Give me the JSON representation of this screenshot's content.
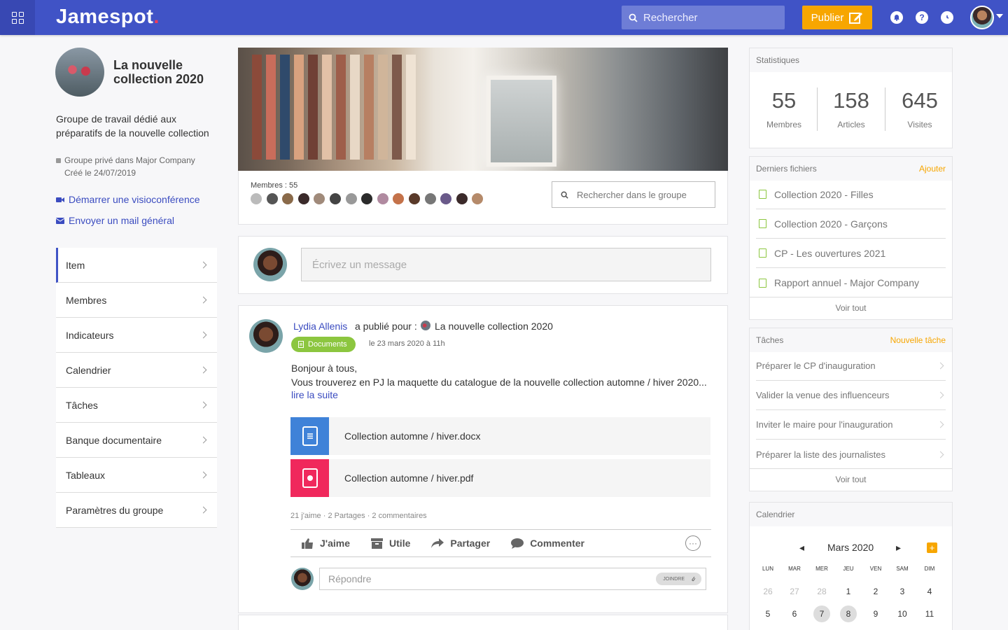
{
  "app": {
    "logo": "Jamespot",
    "logo_dot": ".",
    "search_placeholder": "Rechercher",
    "publish_label": "Publier",
    "colors": {
      "primary": "#4053c6",
      "accent": "#f7a600",
      "pink": "#ef3b5a",
      "green": "#8cc63f"
    },
    "icons": [
      "apps-grid-icon",
      "search-icon",
      "edit-icon",
      "notification-bell-icon",
      "help-icon",
      "clock-icon"
    ]
  },
  "group": {
    "title": "La nouvelle collection 2020",
    "description": "Groupe de travail dédié aux préparatifs de la nouvelle collection",
    "privacy": "Groupe privé dans Major Company",
    "created": "Créé le 24/07/2019",
    "links": [
      {
        "label": "Démarrer une visioconférence",
        "icon": "video-camera-icon"
      },
      {
        "label": "Envoyer un mail général",
        "icon": "envelope-icon"
      }
    ],
    "nav": [
      {
        "label": "Item"
      },
      {
        "label": "Membres"
      },
      {
        "label": "Indicateurs"
      },
      {
        "label": "Calendrier"
      },
      {
        "label": "Tâches"
      },
      {
        "label": "Banque documentaire"
      },
      {
        "label": "Tableaux"
      },
      {
        "label": "Paramètres du groupe"
      }
    ]
  },
  "main": {
    "members_label": "Membres : 55",
    "group_search_placeholder": "Rechercher dans le groupe",
    "compose_placeholder": "Écrivez un message",
    "post": {
      "author": "Lydia Allenis",
      "published_for": "a publié pour :",
      "target": "La nouvelle collection 2020",
      "tag": "Documents",
      "date": "le 23 mars 2020 à 11h",
      "line1": "Bonjour à tous,",
      "line2": "Vous trouverez en PJ la maquette du catalogue de la nouvelle collection automne / hiver 2020...",
      "read_more": "lire la suite",
      "files": [
        {
          "name": "Collection automne / hiver.docx",
          "color": "#3f82d8",
          "icon": "document-icon"
        },
        {
          "name": "Collection automne / hiver.pdf",
          "color": "#f0285c",
          "icon": "pdf-icon"
        }
      ],
      "stats": "21 j'aime · 2 Partages · 2 commentaires",
      "actions": [
        {
          "label": "J'aime",
          "icon": "thumbs-up-icon"
        },
        {
          "label": "Utile",
          "icon": "archive-icon"
        },
        {
          "label": "Partager",
          "icon": "share-icon"
        },
        {
          "label": "Commenter",
          "icon": "comment-icon"
        }
      ],
      "more": "···",
      "reply_placeholder": "Répondre",
      "attach_label": "JOINDRE"
    }
  },
  "sidebar": {
    "stats": {
      "title": "Statistiques",
      "items": [
        {
          "value": "55",
          "label": "Membres"
        },
        {
          "value": "158",
          "label": "Articles"
        },
        {
          "value": "645",
          "label": "Visites"
        }
      ]
    },
    "files": {
      "title": "Derniers fichiers",
      "action": "Ajouter",
      "items": [
        "Collection 2020 - Filles",
        "Collection 2020 - Garçons",
        "CP - Les ouvertures 2021",
        "Rapport annuel - Major Company"
      ],
      "see_all": "Voir tout"
    },
    "tasks": {
      "title": "Tâches",
      "action": "Nouvelle tâche",
      "items": [
        "Préparer le CP d'inauguration",
        "Valider la venue des influenceurs",
        "Inviter le maire pour l'inauguration",
        "Préparer la liste des journalistes"
      ],
      "see_all": "Voir tout"
    },
    "calendar": {
      "title": "Calendrier",
      "month": "Mars 2020",
      "prev": "◂",
      "next": "▸",
      "add": "+",
      "days": [
        "LUN",
        "MAR",
        "MER",
        "JEU",
        "VEN",
        "SAM",
        "DIM"
      ],
      "week1": [
        "26",
        "27",
        "28",
        "1",
        "2",
        "3",
        "4"
      ],
      "week2": [
        "5",
        "6",
        "7",
        "8",
        "9",
        "10",
        "11"
      ]
    }
  }
}
